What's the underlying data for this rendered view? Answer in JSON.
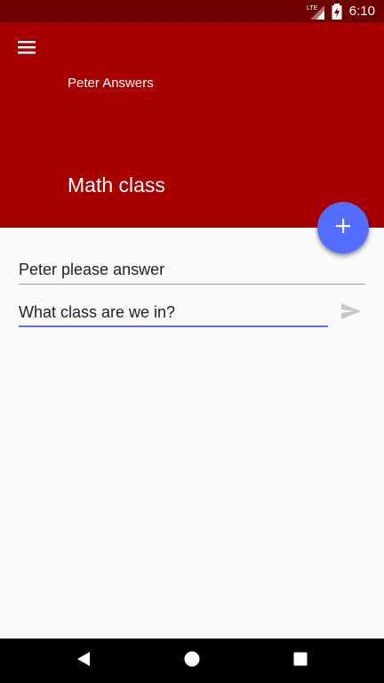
{
  "status_bar": {
    "network_label": "LTE",
    "time": "6:10",
    "background": "#6e0000"
  },
  "app_bar": {
    "title": "Peter Answers",
    "heading": "Math class",
    "background": "#a80000",
    "menu_icon": "hamburger-menu-icon"
  },
  "fab": {
    "icon": "plus-icon",
    "color": "#536dfe"
  },
  "form": {
    "field_1_value": "Peter please answer",
    "field_2_value": "What class are we in?",
    "send_icon": "send-icon",
    "accent": "#536dfe"
  },
  "nav_bar": {
    "back_icon": "back-triangle-icon",
    "home_icon": "home-circle-icon",
    "recents_icon": "recents-square-icon"
  }
}
